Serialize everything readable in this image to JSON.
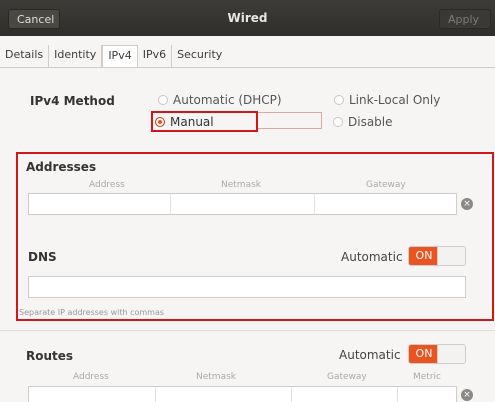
{
  "window": {
    "title": "Wired",
    "cancel_label": "Cancel",
    "apply_label": "Apply"
  },
  "tabs": [
    {
      "label": "Details",
      "active": false
    },
    {
      "label": "Identity",
      "active": false
    },
    {
      "label": "IPv4",
      "active": true
    },
    {
      "label": "IPv6",
      "active": false
    },
    {
      "label": "Security",
      "active": false
    }
  ],
  "ipv4_method": {
    "label": "IPv4 Method",
    "options": {
      "dhcp": "Automatic (DHCP)",
      "link_local": "Link-Local Only",
      "manual": "Manual",
      "disable": "Disable"
    },
    "selected": "Manual"
  },
  "addresses": {
    "title": "Addresses",
    "columns": [
      "Address",
      "Netmask",
      "Gateway"
    ],
    "row": {
      "address": "",
      "netmask": "",
      "gateway": ""
    }
  },
  "dns": {
    "title": "DNS",
    "automatic_label": "Automatic",
    "switch_label": "ON",
    "switch_on": true,
    "value": "",
    "hint": "Separate IP addresses with commas"
  },
  "routes": {
    "title": "Routes",
    "automatic_label": "Automatic",
    "switch_label": "ON",
    "switch_on": true,
    "columns": [
      "Address",
      "Netmask",
      "Gateway",
      "Metric"
    ]
  },
  "colors": {
    "accent": "#e95420",
    "highlight_box": "#d0181b",
    "header_bg": "#3d3c38"
  }
}
